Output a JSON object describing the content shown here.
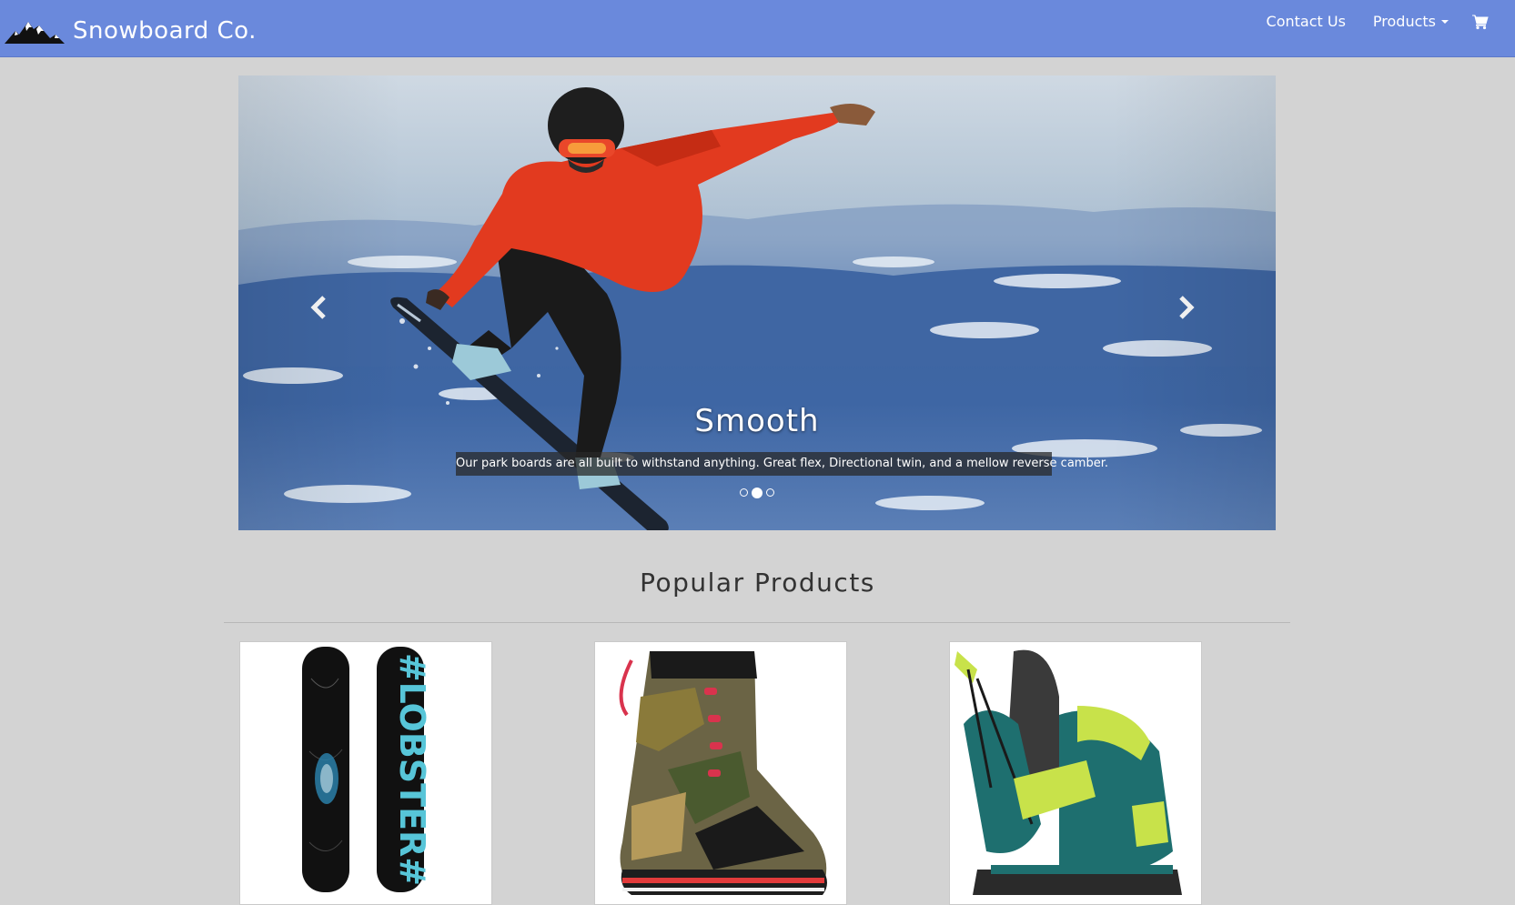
{
  "brand": {
    "name": "Snowboard Co.",
    "logo_icon": "mountain-logo-icon"
  },
  "nav": {
    "contact_label": "Contact Us",
    "products_label": "Products",
    "cart_icon": "shopping-cart-icon"
  },
  "carousel": {
    "slide_title": "Smooth",
    "slide_text": "Our park boards are all built to withstand anything. Great flex, Directional twin, and a mellow reverse camber.",
    "prev_icon": "chevron-left-icon",
    "next_icon": "chevron-right-icon",
    "slide_count": 3,
    "active_slide": 2
  },
  "popular": {
    "title": "Popular Products",
    "products": [
      {
        "image": "snowboard-image"
      },
      {
        "image": "snowboard-boot-image"
      },
      {
        "image": "snowboard-binding-image"
      }
    ]
  },
  "colors": {
    "navbar": "#6a89dc",
    "background": "#d3d3d3",
    "accent_red": "#e23a1f"
  }
}
